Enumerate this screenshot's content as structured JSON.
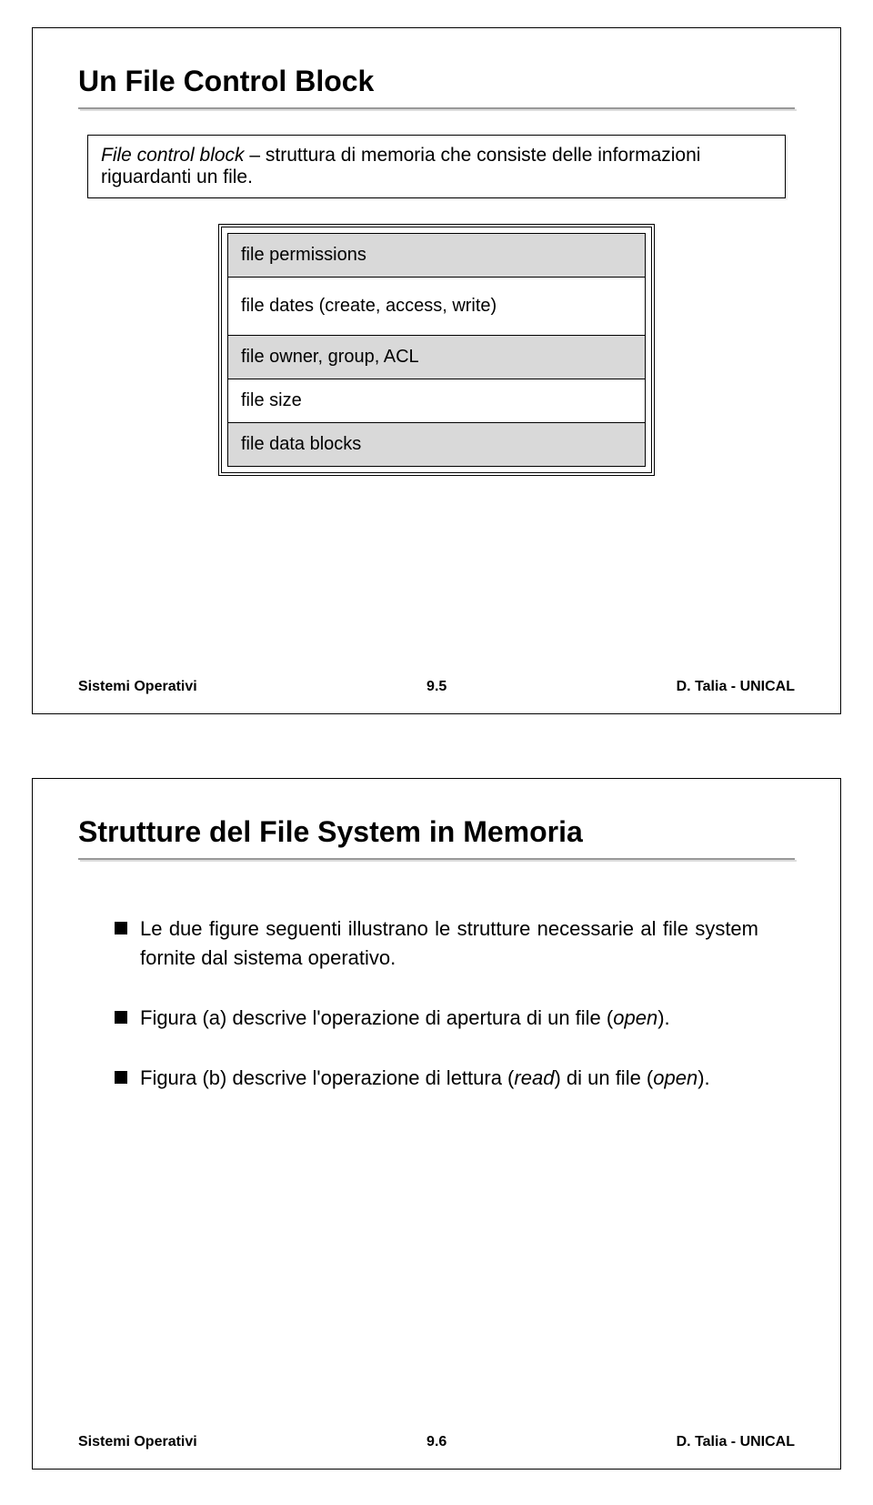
{
  "slide1": {
    "title": "Un File Control Block",
    "definition_prefix_italic": "File control block",
    "definition_rest": " – struttura di memoria che consiste delle informazioni riguardanti un file.",
    "fcb": {
      "permissions": "file permissions",
      "dates": "file dates (create, access, write)",
      "owner": "file owner, group, ACL",
      "size": "file size",
      "blocks": "file data blocks"
    },
    "footer_left": "Sistemi Operativi",
    "footer_mid": "9.5",
    "footer_right": "D. Talia - UNICAL"
  },
  "slide2": {
    "title": "Strutture del File System in Memoria",
    "bullet1": "Le due figure seguenti illustrano le strutture necessarie al file system fornite dal sistema operativo.",
    "bullet2_prefix": "Figura (a) descrive l'operazione di apertura di un file (",
    "bullet2_italic": "open",
    "bullet2_suffix": ").",
    "bullet3_prefix": "Figura (b) descrive l'operazione di lettura (",
    "bullet3_italic": "read",
    "bullet3_mid": ") di un file (",
    "bullet3_italic2": "open",
    "bullet3_suffix": ").",
    "footer_left": "Sistemi Operativi",
    "footer_mid": "9.6",
    "footer_right": "D. Talia - UNICAL"
  }
}
